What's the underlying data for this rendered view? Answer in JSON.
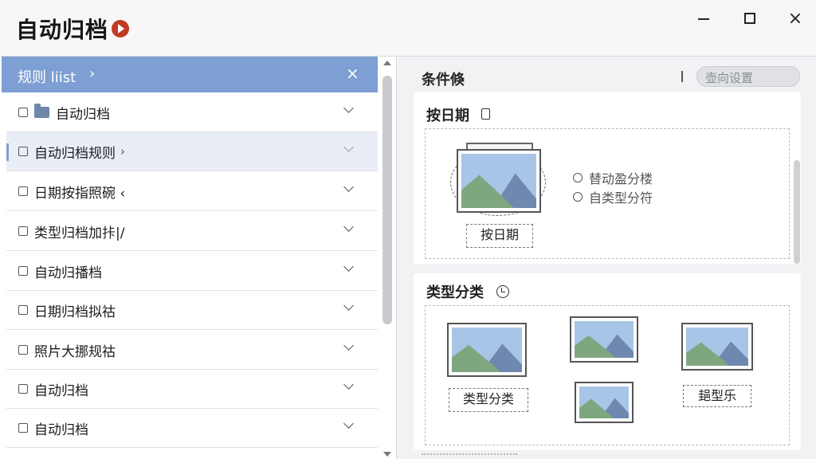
{
  "app": {
    "title": "自动归档",
    "logo": "play-logo-icon"
  },
  "window_controls": {
    "minimize": "minimize-icon",
    "maximize": "maximize-icon",
    "close": "×"
  },
  "list": {
    "header_label": "规则 liist",
    "header_chevron": "›",
    "header_close": "×",
    "items": [
      {
        "label": "自动归档",
        "icon": "folder-icon",
        "selected": false
      },
      {
        "label": "自动归档规则",
        "sub_chevron": "›",
        "selected": true
      },
      {
        "label": "日期按指照碗 ‹",
        "selected": false
      },
      {
        "label": "类型归档加拤|/",
        "selected": false
      },
      {
        "label": "自动归播档",
        "selected": false
      },
      {
        "label": "日期归档拟祜",
        "selected": false
      },
      {
        "label": "照片大挪规祜",
        "selected": false
      },
      {
        "label": "自动归档",
        "selected": false
      },
      {
        "label": "自动归档",
        "selected": false
      }
    ]
  },
  "conditions": {
    "title": "条件倏",
    "settings_button": "壶向设置",
    "date_section": {
      "title": "按日期",
      "image_label": "按日期",
      "options": [
        "替动盈分楼",
        "自类型分符"
      ]
    },
    "type_section": {
      "title": "类型分类",
      "labels": [
        "类型分类",
        "郌型乐"
      ]
    }
  },
  "colors": {
    "header_bg": "#7d9fd3",
    "selected_row_bg": "#e9edf6",
    "logo": "#c23a22",
    "sky": "#a8c4e6",
    "mountain_back": "#6e88b0",
    "mountain_front": "#7fa77f"
  }
}
